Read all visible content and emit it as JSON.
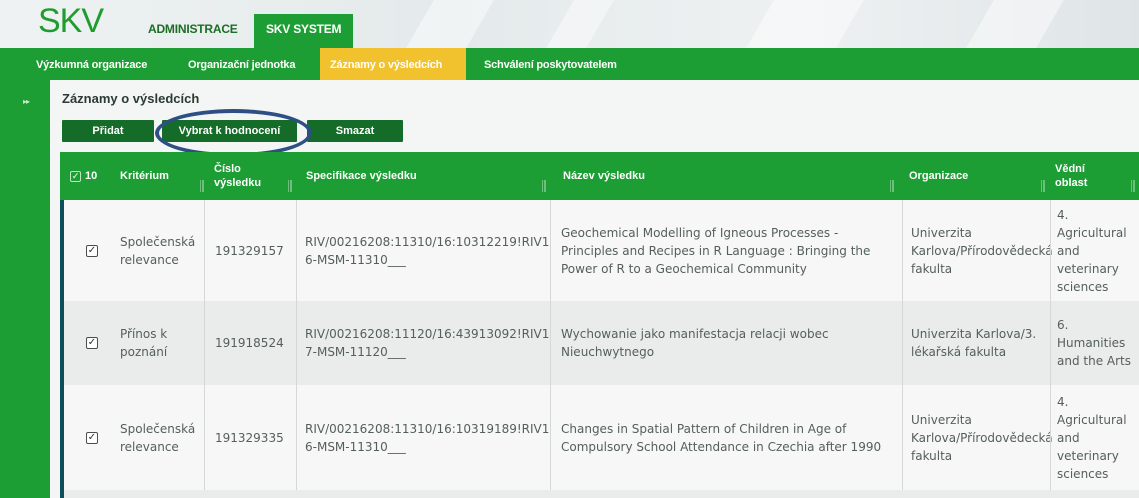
{
  "brand": {
    "logo": "SKV"
  },
  "top_tabs": [
    {
      "label": "ADMINISTRACE",
      "active": false
    },
    {
      "label": "SKV SYSTEM",
      "active": true
    }
  ],
  "sub_nav": [
    {
      "label": "Výzkumná organizace",
      "active": false
    },
    {
      "label": "Organizační jednotka",
      "active": false
    },
    {
      "label": "Záznamy o výsledcích",
      "active": true
    },
    {
      "label": "Schválení poskytovatelem",
      "active": false
    }
  ],
  "rail": {
    "toggle_icon": "double-chevron-right-icon",
    "glyph": "▸▸"
  },
  "section": {
    "title": "Záznamy o výsledcích"
  },
  "actions": {
    "add_label": "Přidat",
    "select_label": "Vybrat k hodnocení",
    "delete_label": "Smazat"
  },
  "table": {
    "selected_count": "10",
    "headers": {
      "criterion": "Kritérium",
      "number_line1": "Číslo",
      "number_line2": "výsledku",
      "spec": "Specifikace výsledku",
      "name": "Název výsledku",
      "org": "Organizace",
      "field_line1": "Vědní",
      "field_line2": "oblast"
    },
    "rows": [
      {
        "checked": true,
        "criterion": "Společenská relevance",
        "number": "191329157",
        "spec": "RIV/00216208:11310/16:10312219!RIV16-MSM-11310___",
        "name": "Geochemical Modelling of Igneous Processes - Principles and Recipes in R Language : Bringing the Power of R to a Geochemical Community",
        "org": "Univerzita Karlova/Přírodovědecká fakulta",
        "field": "4. Agricultural and veterinary sciences"
      },
      {
        "checked": true,
        "criterion": "Přínos k poznání",
        "number": "191918524",
        "spec": "RIV/00216208:11120/16:43913092!RIV17-MSM-11120___",
        "name": "Wychowanie jako manifestacja relacji wobec Nieuchwytnego",
        "org": "Univerzita Karlova/3. lékařská fakulta",
        "field": "6. Humanities and the Arts"
      },
      {
        "checked": true,
        "criterion": "Společenská relevance",
        "number": "191329335",
        "spec": "RIV/00216208:11310/16:10319189!RIV16-MSM-11310___",
        "name": "Changes in Spatial Pattern of Children in Age of Compulsory School Attendance in Czechia after 1990",
        "org": "Univerzita Karlova/Přírodovědecká fakulta",
        "field": "4. Agricultural and veterinary sciences"
      }
    ]
  },
  "colors": {
    "primary_green": "#1d9e34",
    "dark_button": "#156b28",
    "active_tab": "#f2c12e",
    "row_accent": "#0f4f5c",
    "highlight_ellipse": "#2d4f84"
  }
}
